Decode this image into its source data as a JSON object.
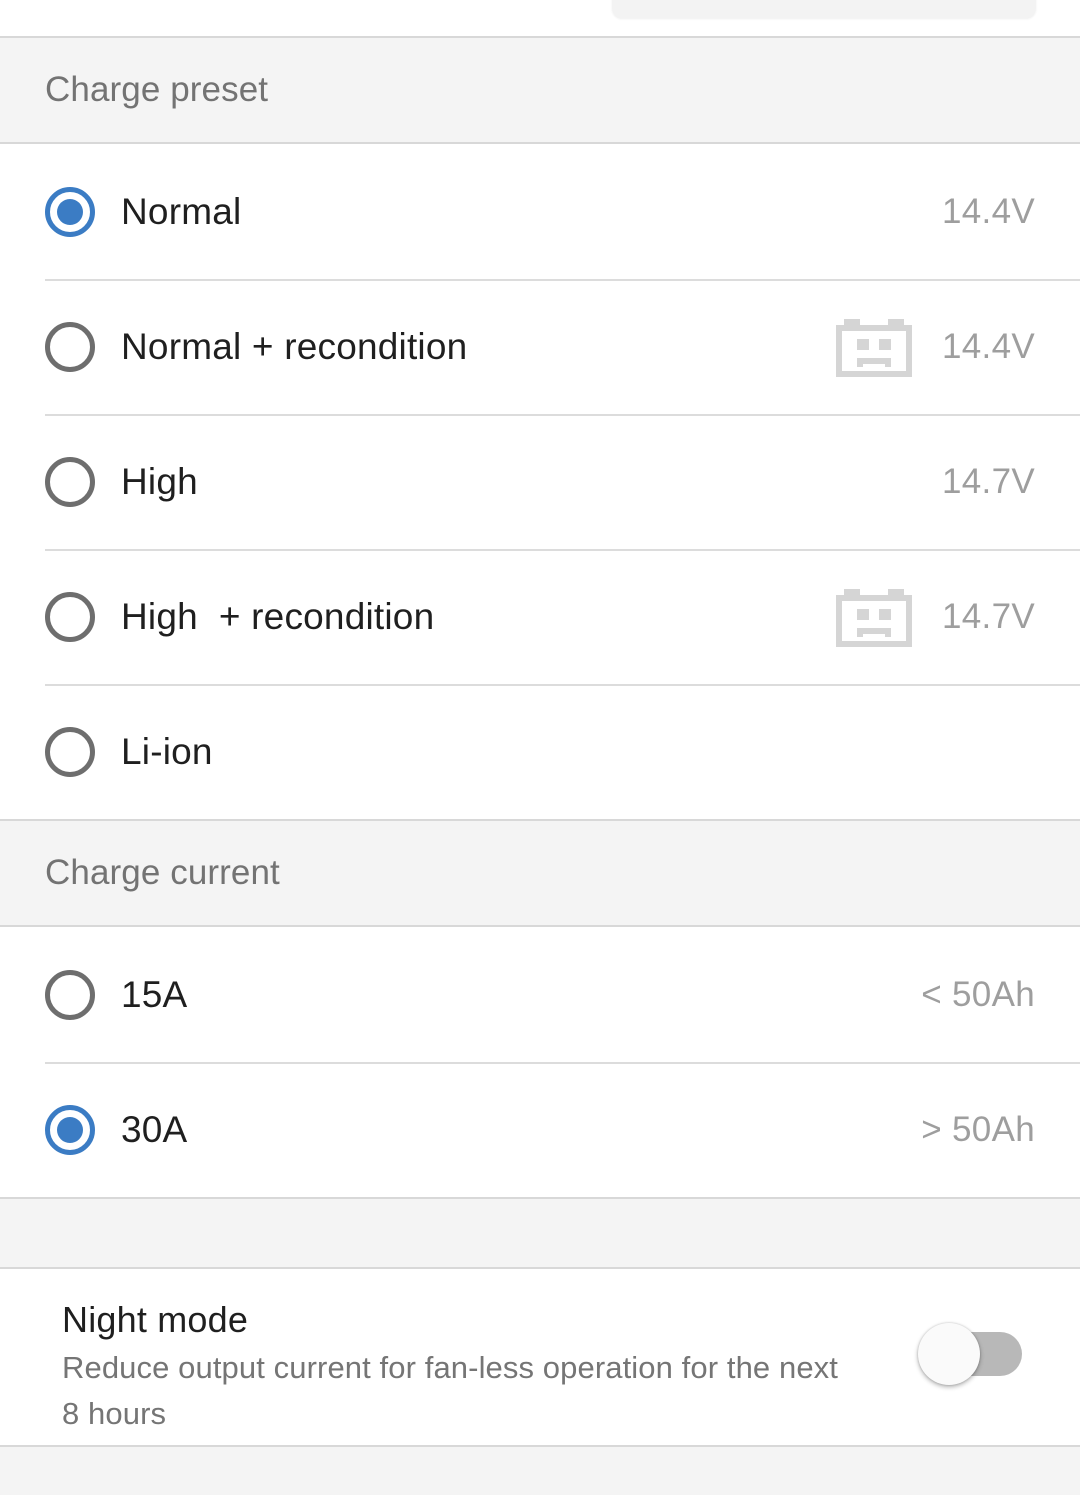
{
  "colors": {
    "accent": "#3b7cc4",
    "radio_off": "#6e6e6e",
    "label": "#1f1f1f",
    "value": "#9e9e9e",
    "section_bg": "#f4f4f4",
    "section_text": "#737373",
    "divider": "#dcdcdc",
    "toggle_track": "#b8b8b8",
    "toggle_knob": "#fafafa"
  },
  "top_partial_card": {
    "name": "partial-card-cutoff"
  },
  "sections": [
    {
      "header": "Charge preset",
      "rows": [
        {
          "label": "Normal",
          "value": "14.4V",
          "selected": true,
          "icon": null,
          "icon_name": null
        },
        {
          "label": "Normal + recondition",
          "value": "14.4V",
          "selected": false,
          "icon": "battery-recondition-icon",
          "icon_name": "battery-recondition-icon"
        },
        {
          "label": "High",
          "value": "14.7V",
          "selected": false,
          "icon": null,
          "icon_name": null
        },
        {
          "label": "High  + recondition",
          "value": "14.7V",
          "selected": false,
          "icon": "battery-recondition-icon",
          "icon_name": "battery-recondition-icon"
        },
        {
          "label": "Li-ion",
          "value": "",
          "selected": false,
          "icon": null,
          "icon_name": null
        }
      ]
    },
    {
      "header": "Charge current",
      "rows": [
        {
          "label": "15A",
          "value": "< 50Ah",
          "selected": false,
          "icon": null,
          "icon_name": null
        },
        {
          "label": "30A",
          "value": "> 50Ah",
          "selected": true,
          "icon": null,
          "icon_name": null
        }
      ]
    }
  ],
  "night_mode": {
    "title": "Night mode",
    "subtitle": "Reduce output current for fan-less operation for the next 8 hours",
    "toggle_on": false,
    "toggle_name": "night-mode-toggle"
  }
}
